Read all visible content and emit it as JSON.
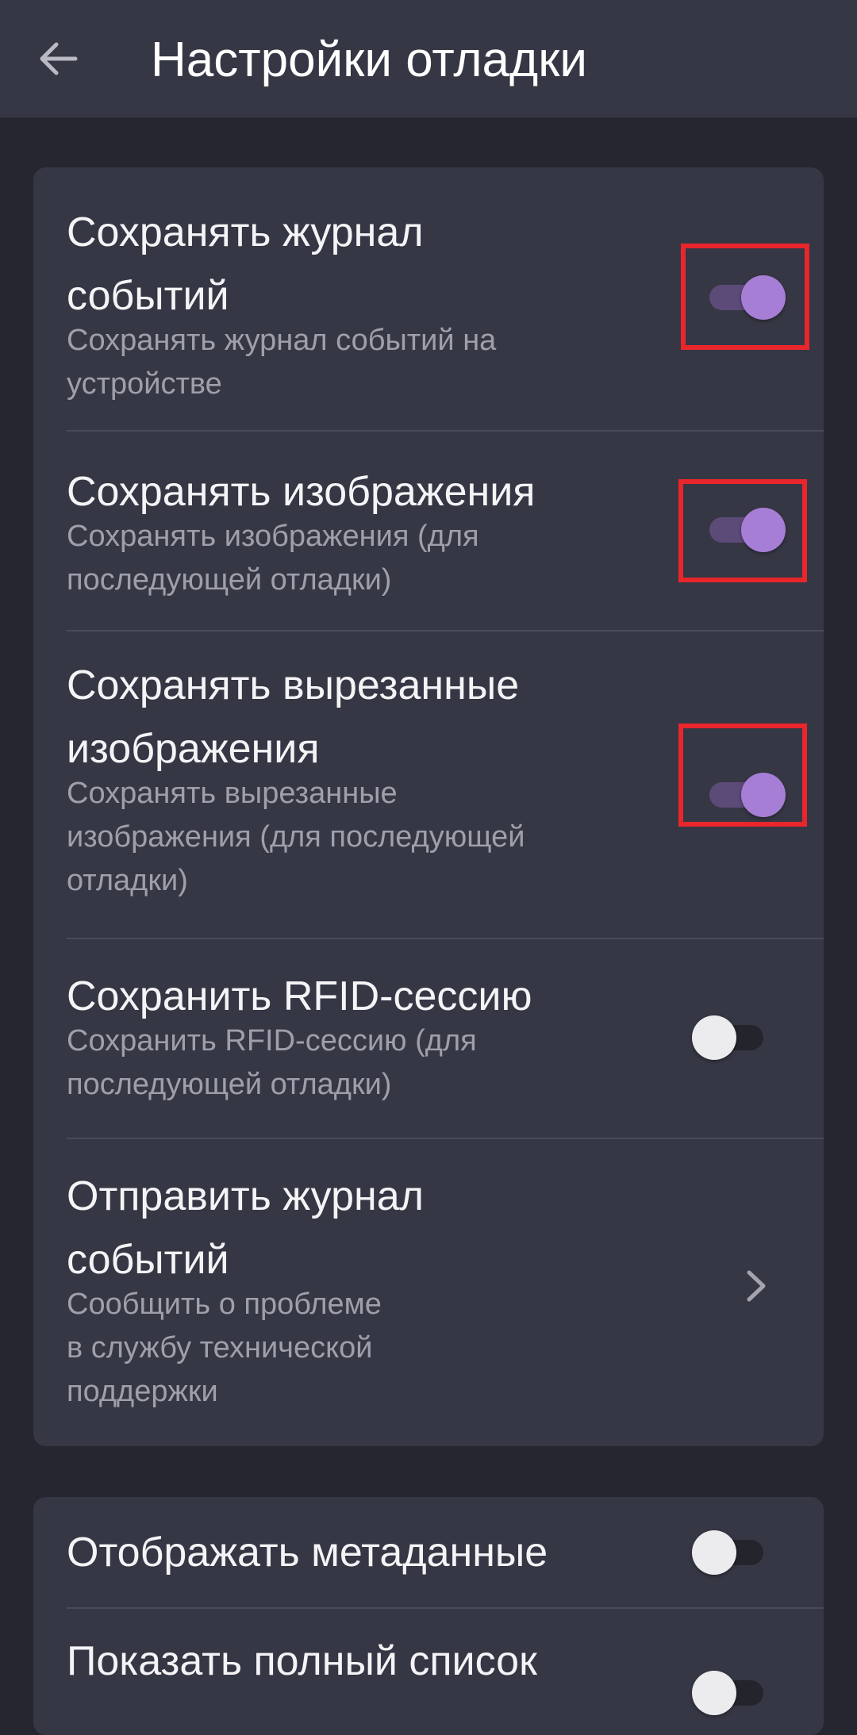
{
  "appbar": {
    "title": "Настройки отладки",
    "back_icon": "arrow-left-icon"
  },
  "colors": {
    "background": "#262630",
    "card": "#363744",
    "accent": "#a77ed6",
    "highlight": "#e8262c"
  },
  "section1": {
    "items": [
      {
        "title_line1": "Сохранять журнал",
        "title_line2": "событий",
        "sub_line1": "Сохранять журнал событий на",
        "sub_line2": "устройстве",
        "control": "toggle",
        "checked": true
      },
      {
        "title_line1": "Сохранять изображения",
        "sub_line1": "Сохранять изображения (для",
        "sub_line2": "последующей отладки)",
        "control": "toggle",
        "checked": true
      },
      {
        "title_line1": "Сохранять вырезанные",
        "title_line2": "изображения",
        "sub_line1": "Сохранять вырезанные",
        "sub_line2": "изображения (для последующей",
        "sub_line3": "отладки)",
        "control": "toggle",
        "checked": true
      },
      {
        "title_line1": "Сохранить RFID-сессию",
        "sub_line1": "Сохранить RFID-сессию (для",
        "sub_line2": "последующей отладки)",
        "control": "toggle",
        "checked": false
      },
      {
        "title_line1": "Отправить журнал",
        "title_line2": "событий",
        "sub_line1": "Сообщить о проблеме",
        "sub_line2": "в службу технической",
        "sub_line3": "поддержки",
        "control": "chevron",
        "icon": "chevron-right-icon"
      }
    ]
  },
  "section2": {
    "items": [
      {
        "title_line1": "Отображать метаданные",
        "control": "toggle",
        "checked": false
      },
      {
        "title_line1": "Показать полный список",
        "control": "toggle",
        "checked": false
      }
    ]
  }
}
